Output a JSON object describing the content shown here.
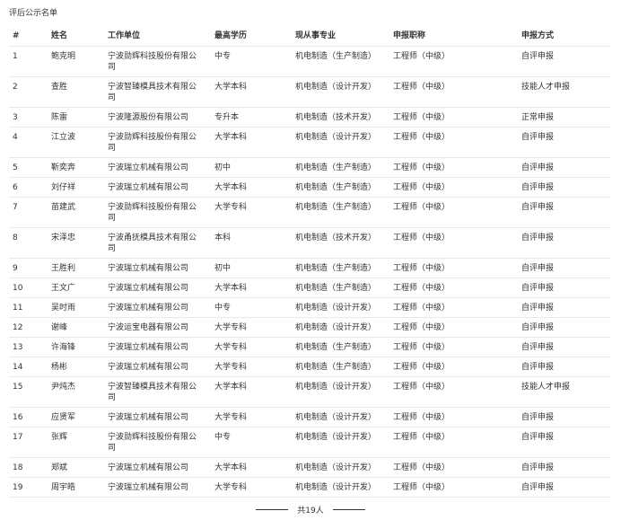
{
  "title": "评后公示名单",
  "columns": [
    "#",
    "姓名",
    "工作单位",
    "最高学历",
    "现从事专业",
    "申报职称",
    "申报方式"
  ],
  "rows": [
    [
      "1",
      "鲍克明",
      "宁波勋辉科技股份有限公司",
      "中专",
      "机电制造（生产制造）",
      "工程师（中级）",
      "自评申报"
    ],
    [
      "2",
      "查胜",
      "宁波智臻模具技术有限公司",
      "大学本科",
      "机电制造（设计开发）",
      "工程师（中级）",
      "技能人才申报"
    ],
    [
      "3",
      "陈雷",
      "宁波隆源股份有限公司",
      "专升本",
      "机电制造（技术开发）",
      "工程师（中级）",
      "正常申报"
    ],
    [
      "4",
      "江立波",
      "宁波勋辉科技股份有限公司",
      "大学本科",
      "机电制造（设计开发）",
      "工程师（中级）",
      "自评申报"
    ],
    [
      "5",
      "靳奕奔",
      "宁波瑞立机械有限公司",
      "初中",
      "机电制造（生产制造）",
      "工程师（中级）",
      "自评申报"
    ],
    [
      "6",
      "刘仔祥",
      "宁波瑞立机械有限公司",
      "大学本科",
      "机电制造（生产制造）",
      "工程师（中级）",
      "自评申报"
    ],
    [
      "7",
      "苗建武",
      "宁波勋辉科技股份有限公司",
      "大学专科",
      "机电制造（生产制造）",
      "工程师（中级）",
      "自评申报"
    ],
    [
      "8",
      "宋泽忠",
      "宁波甬抚模具技术有限公司",
      "本科",
      "机电制造（技术开发）",
      "工程师（中级）",
      "自评申报"
    ],
    [
      "9",
      "王胜利",
      "宁波瑞立机械有限公司",
      "初中",
      "机电制造（生产制造）",
      "工程师（中级）",
      "自评申报"
    ],
    [
      "10",
      "王文广",
      "宁波瑞立机械有限公司",
      "大学本科",
      "机电制造（生产制造）",
      "工程师（中级）",
      "自评申报"
    ],
    [
      "11",
      "吴时雨",
      "宁波瑞立机械有限公司",
      "中专",
      "机电制造（设计开发）",
      "工程师（中级）",
      "自评申报"
    ],
    [
      "12",
      "谢峰",
      "宁波运宝电器有限公司",
      "大学专科",
      "机电制造（设计开发）",
      "工程师（中级）",
      "自评申报"
    ],
    [
      "13",
      "许海锋",
      "宁波瑞立机械有限公司",
      "大学专科",
      "机电制造（生产制造）",
      "工程师（中级）",
      "自评申报"
    ],
    [
      "14",
      "杨彬",
      "宁波瑞立机械有限公司",
      "大学专科",
      "机电制造（生产制造）",
      "工程师（中级）",
      "自评申报"
    ],
    [
      "15",
      "尹炖杰",
      "宁波智臻模具技术有限公司",
      "大学本科",
      "机电制造（设计开发）",
      "工程师（中级）",
      "技能人才申报"
    ],
    [
      "16",
      "应贤军",
      "宁波瑞立机械有限公司",
      "大学专科",
      "机电制造（设计开发）",
      "工程师（中级）",
      "自评申报"
    ],
    [
      "17",
      "张辉",
      "宁波勋辉科技股份有限公司",
      "中专",
      "机电制造（设计开发）",
      "工程师（中级）",
      "自评申报"
    ],
    [
      "18",
      "郑斌",
      "宁波瑞立机械有限公司",
      "大学本科",
      "机电制造（设计开发）",
      "工程师（中级）",
      "自评申报"
    ],
    [
      "19",
      "周宇皓",
      "宁波瑞立机械有限公司",
      "大学专科",
      "机电制造（设计开发）",
      "工程师（中级）",
      "自评申报"
    ]
  ],
  "footer": {
    "total_label": "共19人"
  }
}
